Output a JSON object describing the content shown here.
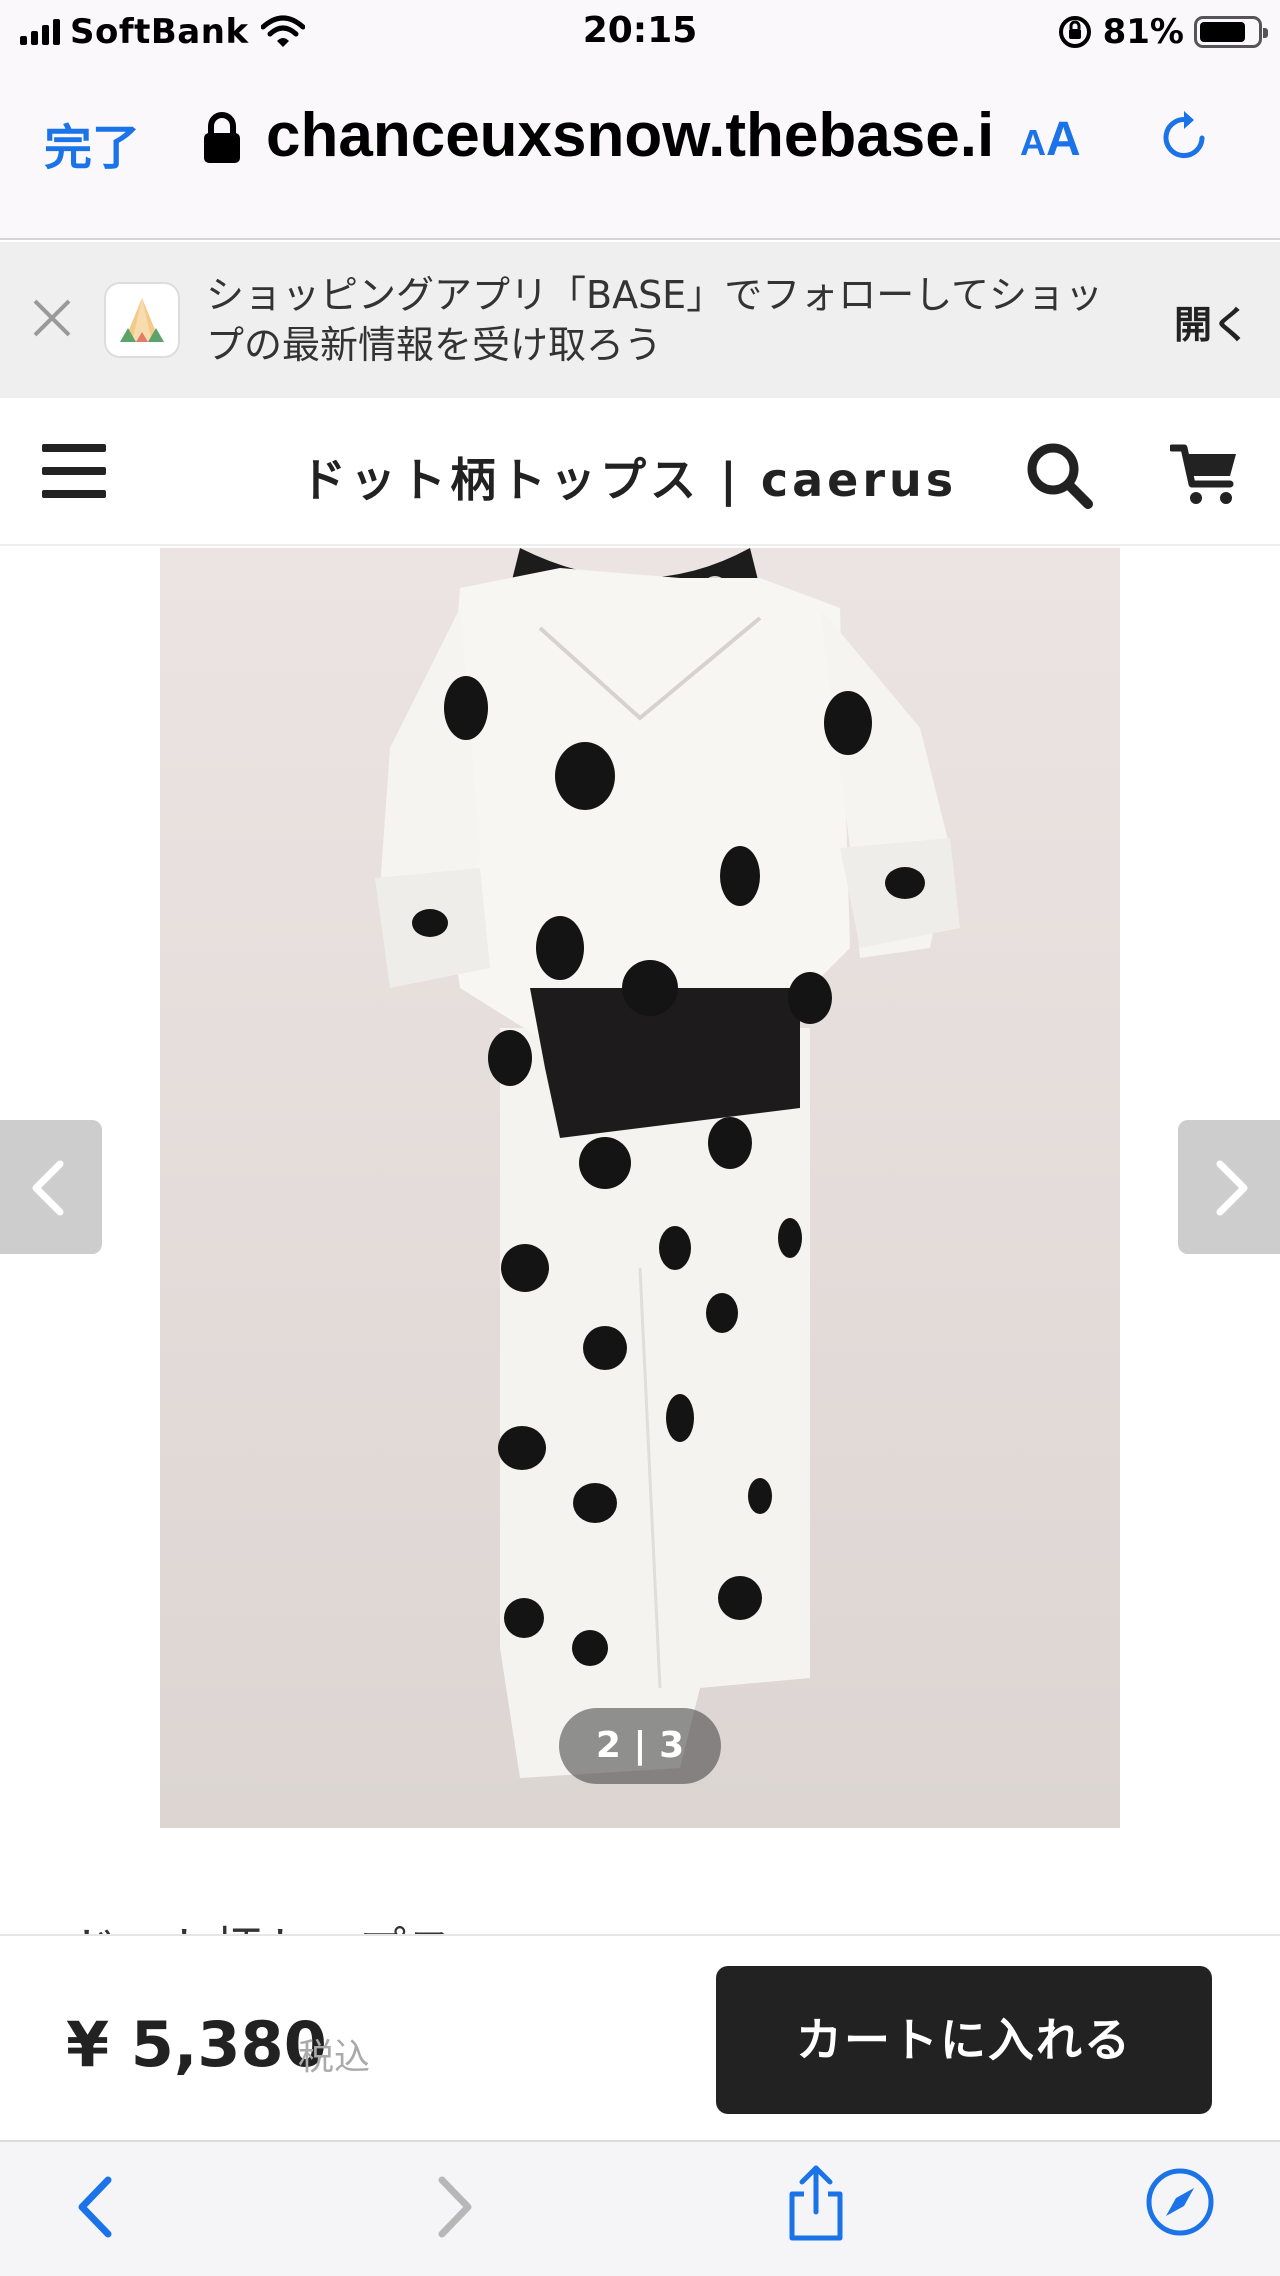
{
  "status_bar": {
    "carrier": "SoftBank",
    "time": "20:15",
    "battery_percent": "81%",
    "battery_level": 0.81
  },
  "url_bar": {
    "done_label": "完了",
    "url": "chanceuxsnow.thebase.in",
    "text_size_label_small": "A",
    "text_size_label_large": "A"
  },
  "app_banner": {
    "text": "ショッピングアプリ「BASE」でフォローしてショップの最新情報を受け取ろう",
    "open_label": "開く"
  },
  "header": {
    "title": "ドット柄トップス | caerus ..."
  },
  "gallery": {
    "counter": "2 | 3",
    "current": 2,
    "total": 3
  },
  "product": {
    "name_partial": "ドット柄トップス"
  },
  "purchase": {
    "price": "¥ 5,380",
    "tax_label": "税込",
    "add_to_cart_label": "カートに入れる"
  },
  "icons": {
    "lock": "lock-icon",
    "reload": "reload-icon",
    "menu": "hamburger-menu-icon",
    "search": "search-icon",
    "cart": "cart-icon",
    "back": "back-icon",
    "forward": "forward-icon",
    "share": "share-icon",
    "compass": "safari-compass-icon"
  },
  "colors": {
    "ios_blue": "#1a73e8",
    "button_dark": "#222222"
  }
}
